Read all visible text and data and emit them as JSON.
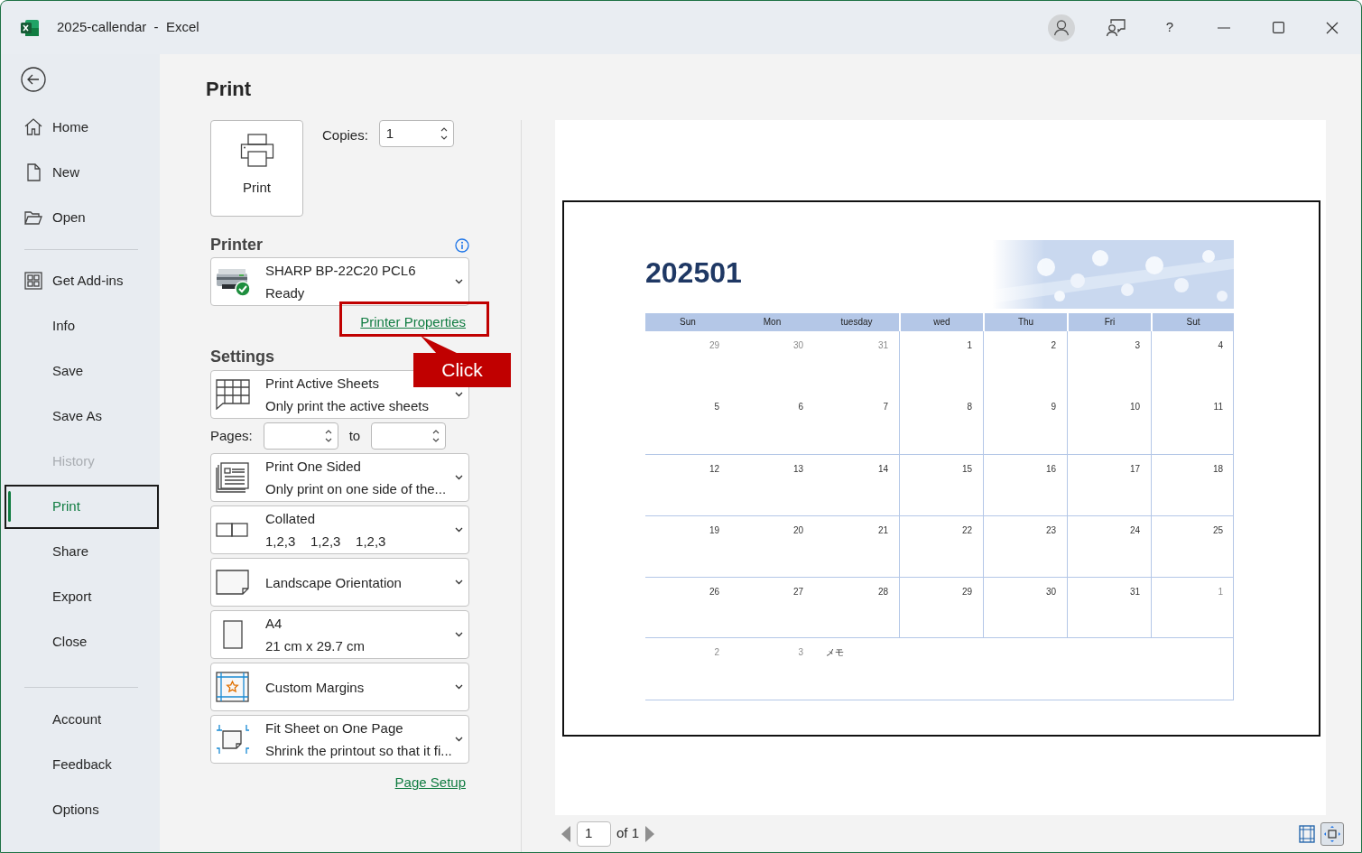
{
  "window": {
    "title": "2025-callendar  -  Excel",
    "help": "?"
  },
  "sidebar": {
    "groups": [
      {
        "items": [
          {
            "label": "Home",
            "selected": false,
            "disabled": false
          },
          {
            "label": "New",
            "selected": false,
            "disabled": false
          },
          {
            "label": "Open",
            "selected": false,
            "disabled": false
          }
        ]
      },
      {
        "items": [
          {
            "label": "Get Add-ins",
            "selected": false,
            "disabled": false
          },
          {
            "label": "Info",
            "selected": false,
            "disabled": false
          },
          {
            "label": "Save",
            "selected": false,
            "disabled": false
          },
          {
            "label": "Save As",
            "selected": false,
            "disabled": false
          },
          {
            "label": "History",
            "selected": false,
            "disabled": true
          },
          {
            "label": "Print",
            "selected": true,
            "disabled": false
          },
          {
            "label": "Share",
            "selected": false,
            "disabled": false
          },
          {
            "label": "Export",
            "selected": false,
            "disabled": false
          },
          {
            "label": "Close",
            "selected": false,
            "disabled": false
          }
        ]
      },
      {
        "items": [
          {
            "label": "Account",
            "selected": false,
            "disabled": false
          },
          {
            "label": "Feedback",
            "selected": false,
            "disabled": false
          },
          {
            "label": "Options",
            "selected": false,
            "disabled": false
          }
        ]
      }
    ]
  },
  "print_pane": {
    "title": "Print",
    "print_button": "Print",
    "copies": {
      "label": "Copies:",
      "value": "1"
    },
    "printer": {
      "heading": "Printer",
      "name": "SHARP BP-22C20 PCL6",
      "status": "Ready",
      "properties_link": "Printer Properties"
    },
    "callout": {
      "text": "Click"
    },
    "settings": {
      "heading": "Settings",
      "dropdowns": [
        {
          "kind": "sheets",
          "title": "Print Active Sheets",
          "subtitle": "Only print the active sheets"
        },
        {
          "kind": "pages",
          "label": "Pages:",
          "to": "to"
        },
        {
          "kind": "sided",
          "title": "Print One Sided",
          "subtitle": "Only print on one side of the..."
        },
        {
          "kind": "collated",
          "title": "Collated",
          "subtitle": "1,2,3    1,2,3    1,2,3"
        },
        {
          "kind": "orientation",
          "title": "Landscape Orientation"
        },
        {
          "kind": "paper",
          "title": "A4",
          "subtitle": "21 cm x 29.7 cm"
        },
        {
          "kind": "margins",
          "title": "Custom Margins"
        },
        {
          "kind": "scaling",
          "title": "Fit Sheet on One Page",
          "subtitle": "Shrink the printout so that it fi..."
        }
      ],
      "page_setup_link": "Page Setup"
    }
  },
  "preview": {
    "calendar": {
      "title": "202501",
      "weekdays": [
        "Sun",
        "Mon",
        "tuesday",
        "wed",
        "Thu",
        "Fri",
        "Sut"
      ],
      "weeks": [
        {
          "days": [
            {
              "day": "29",
              "muted": true
            },
            {
              "day": "30",
              "muted": true
            },
            {
              "day": "31",
              "muted": true
            },
            {
              "day": "1",
              "muted": false
            },
            {
              "day": "2",
              "muted": false
            },
            {
              "day": "3",
              "muted": false
            },
            {
              "day": "4",
              "muted": false
            }
          ]
        },
        {
          "days": [
            {
              "day": "5",
              "muted": false
            },
            {
              "day": "6",
              "muted": false
            },
            {
              "day": "7",
              "muted": false
            },
            {
              "day": "8",
              "muted": false
            },
            {
              "day": "9",
              "muted": false
            },
            {
              "day": "10",
              "muted": false
            },
            {
              "day": "11",
              "muted": false
            }
          ]
        },
        {
          "days": [
            {
              "day": "12",
              "muted": false
            },
            {
              "day": "13",
              "muted": false
            },
            {
              "day": "14",
              "muted": false
            },
            {
              "day": "15",
              "muted": false
            },
            {
              "day": "16",
              "muted": false
            },
            {
              "day": "17",
              "muted": false
            },
            {
              "day": "18",
              "muted": false
            }
          ]
        },
        {
          "days": [
            {
              "day": "19",
              "muted": false
            },
            {
              "day": "20",
              "muted": false
            },
            {
              "day": "21",
              "muted": false
            },
            {
              "day": "22",
              "muted": false
            },
            {
              "day": "23",
              "muted": false
            },
            {
              "day": "24",
              "muted": false
            },
            {
              "day": "25",
              "muted": false
            }
          ]
        },
        {
          "days": [
            {
              "day": "26",
              "muted": false
            },
            {
              "day": "27",
              "muted": false
            },
            {
              "day": "28",
              "muted": false
            },
            {
              "day": "29",
              "muted": false
            },
            {
              "day": "30",
              "muted": false
            },
            {
              "day": "31",
              "muted": false
            },
            {
              "day": "1",
              "muted": true
            }
          ]
        },
        {
          "days": [
            {
              "day": "2",
              "muted": true
            },
            {
              "day": "3",
              "muted": true
            }
          ],
          "note": "メモ"
        }
      ]
    },
    "page_nav": {
      "page": "1",
      "of": "of 1"
    },
    "zoom_to_page": {
      "selected": true
    }
  }
}
